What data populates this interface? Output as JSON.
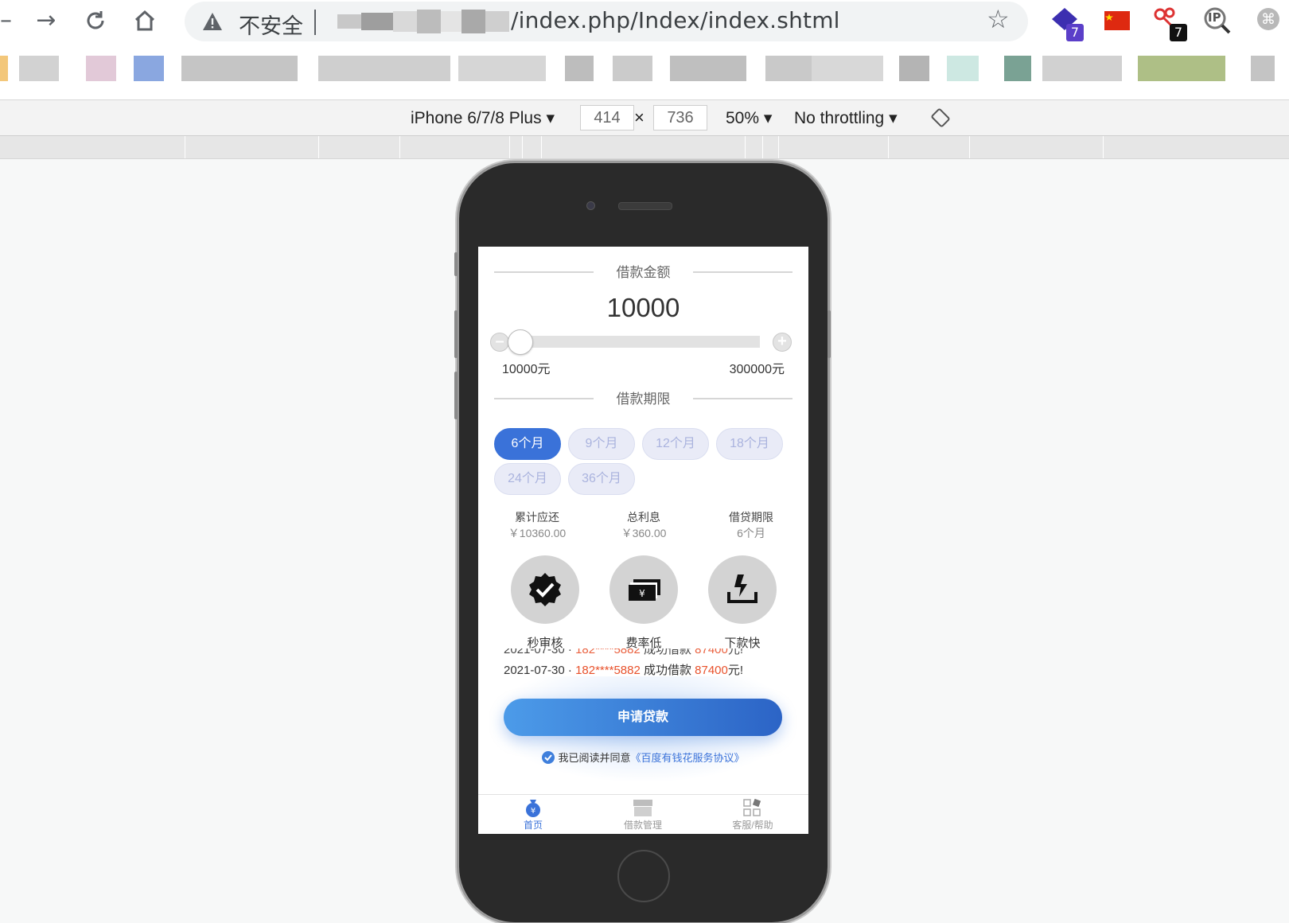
{
  "browser": {
    "security_label": "不安全",
    "url_path": "/index.php/Index/index.shtml",
    "extensions": [
      {
        "name": "tab-manager-extension",
        "badge": "7",
        "badge_color": "#5b3fc9"
      },
      {
        "name": "china-flag-extension"
      },
      {
        "name": "scissors-extension",
        "badge": "7",
        "badge_color": "#111111"
      },
      {
        "name": "ip-lookup-extension",
        "label": "IP"
      },
      {
        "name": "command-extension"
      }
    ]
  },
  "devtools": {
    "device": "iPhone 6/7/8 Plus",
    "width": "414",
    "height": "736",
    "zoom": "50%",
    "throttling": "No throttling",
    "times": "×"
  },
  "app": {
    "loan_amount_title": "借款金额",
    "amount_value": "10000",
    "slider": {
      "min_label": "10000元",
      "max_label": "300000元",
      "value_fraction": 0.0
    },
    "loan_term_title": "借款期限",
    "terms": [
      {
        "label": "6个月",
        "active": true
      },
      {
        "label": "9个月",
        "active": false
      },
      {
        "label": "12个月",
        "active": false
      },
      {
        "label": "18个月",
        "active": false
      },
      {
        "label": "24个月",
        "active": false
      },
      {
        "label": "36个月",
        "active": false
      }
    ],
    "stats": [
      {
        "key": "累计应还",
        "value": "￥10360.00"
      },
      {
        "key": "总利息",
        "value": "￥360.00"
      },
      {
        "key": "借贷期限",
        "value": "6个月"
      }
    ],
    "features": [
      {
        "icon": "verified-badge-icon",
        "label": "秒审核"
      },
      {
        "icon": "cash-icon",
        "label": "费率低"
      },
      {
        "icon": "fast-download-icon",
        "label": "下款快"
      }
    ],
    "ticker": {
      "date": "2021-07-30 · ",
      "phone": "182****5882",
      "middle": " 成功借款 ",
      "amount": "87400",
      "suffix": "元!"
    },
    "apply_button": "申请贷款",
    "agreement_text": "我已阅读并同意",
    "agreement_link": "《百度有钱花服务协议》",
    "tabs": [
      {
        "label": "首页",
        "icon": "money-bag-icon",
        "active": true
      },
      {
        "label": "借款管理",
        "icon": "box-icon",
        "active": false
      },
      {
        "label": "客服/帮助",
        "icon": "grid-icon",
        "active": false
      }
    ],
    "colors": {
      "primary": "#3a72d9",
      "accent_red": "#e8512b",
      "term_inactive_bg": "#e9ebf7"
    }
  }
}
